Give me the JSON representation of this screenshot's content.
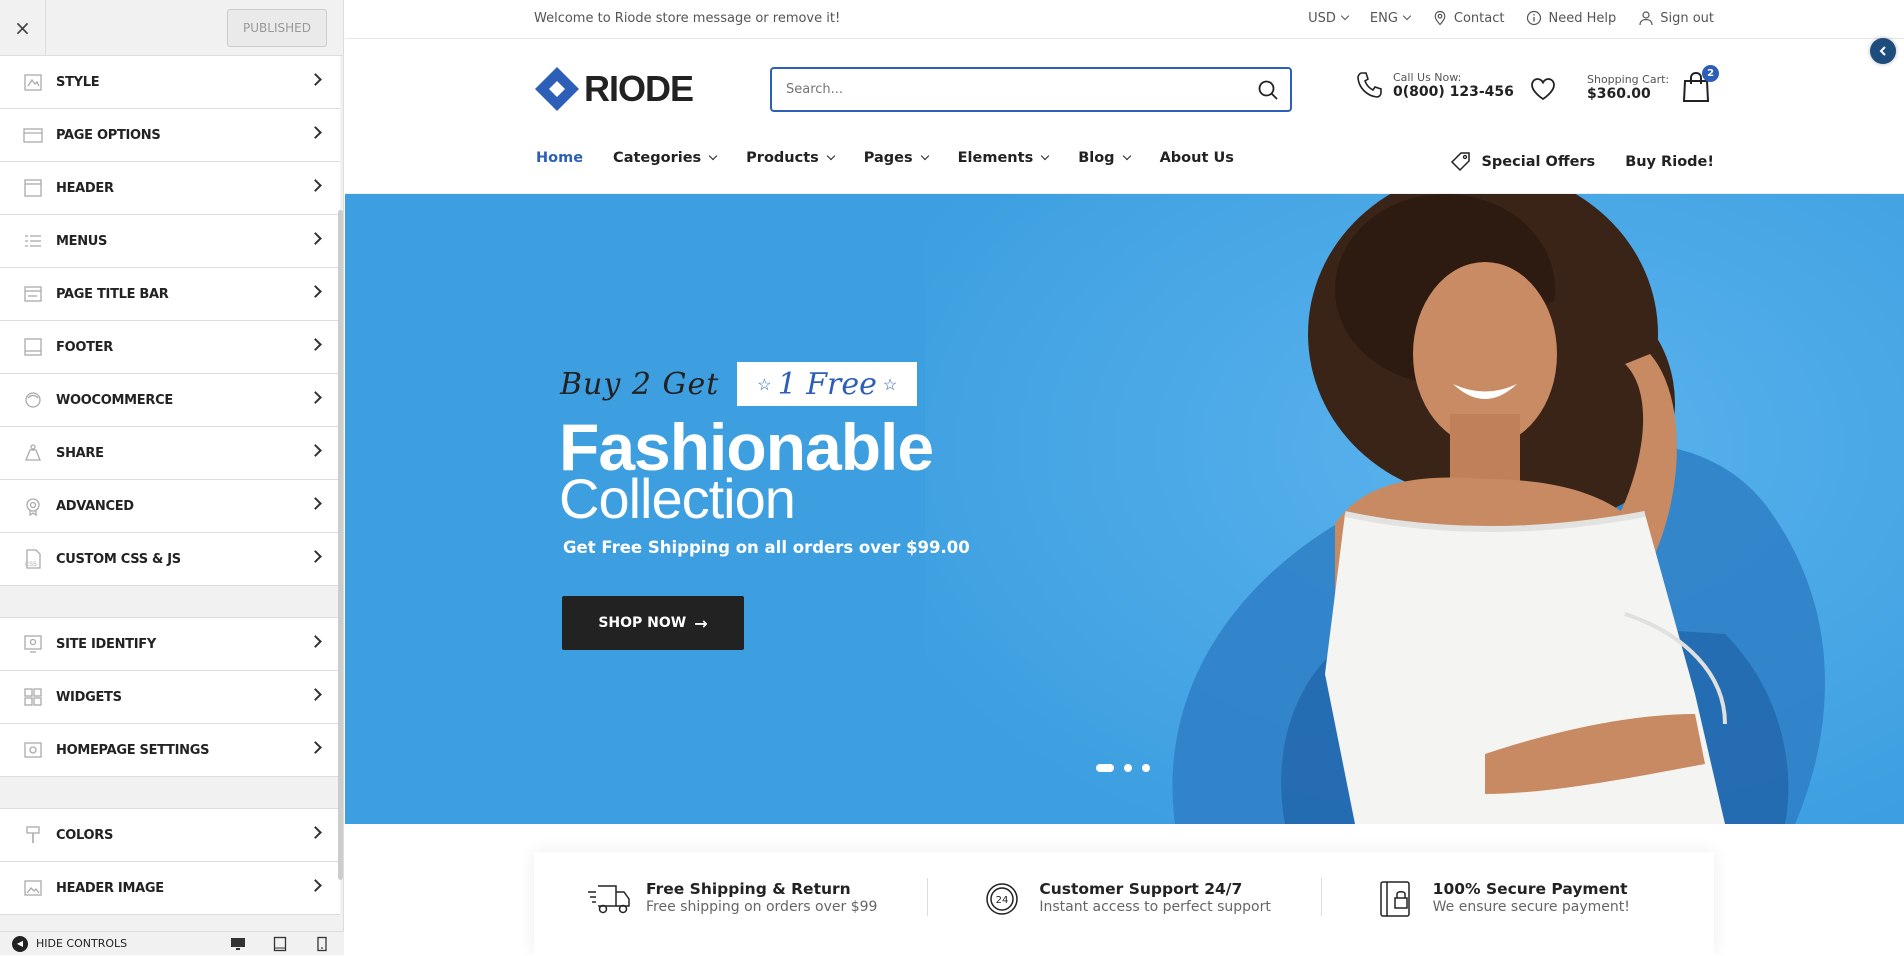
{
  "customizer": {
    "close_label": "×",
    "publish_label": "PUBLISHED",
    "sections_group1": [
      {
        "label": "STYLE",
        "icon": "style-icon"
      },
      {
        "label": "PAGE OPTIONS",
        "icon": "page-options-icon"
      },
      {
        "label": "HEADER",
        "icon": "header-icon"
      },
      {
        "label": "MENUS",
        "icon": "menus-icon"
      },
      {
        "label": "PAGE TITLE BAR",
        "icon": "page-title-bar-icon"
      },
      {
        "label": "FOOTER",
        "icon": "footer-icon"
      },
      {
        "label": "WOOCOMMERCE",
        "icon": "woocommerce-icon"
      },
      {
        "label": "SHARE",
        "icon": "share-icon"
      },
      {
        "label": "ADVANCED",
        "icon": "advanced-icon"
      },
      {
        "label": "CUSTOM CSS & JS",
        "icon": "custom-css-icon"
      }
    ],
    "sections_group2": [
      {
        "label": "SITE IDENTIFY",
        "icon": "site-identity-icon"
      },
      {
        "label": "WIDGETS",
        "icon": "widgets-icon"
      },
      {
        "label": "HOMEPAGE SETTINGS",
        "icon": "homepage-settings-icon"
      }
    ],
    "sections_group3": [
      {
        "label": "COLORS",
        "icon": "colors-icon"
      },
      {
        "label": "HEADER IMAGE",
        "icon": "header-image-icon"
      }
    ],
    "hide_controls_label": "HIDE CONTROLS"
  },
  "topbar": {
    "welcome": "Welcome to Riode store message or remove it!",
    "currency": "USD",
    "language": "ENG",
    "contact": "Contact",
    "help": "Need Help",
    "signout": "Sign out"
  },
  "header": {
    "logo_text": "RIODE",
    "search_placeholder": "Search...",
    "call_label": "Call Us Now:",
    "call_number": "0(800) 123-456",
    "cart_label": "Shopping Cart:",
    "cart_total": "$360.00",
    "cart_count": "2"
  },
  "nav": {
    "items": [
      "Home",
      "Categories",
      "Products",
      "Pages",
      "Elements",
      "Blog",
      "About Us"
    ],
    "special_offers": "Special Offers",
    "buy": "Buy Riode!"
  },
  "hero": {
    "buy_text": "Buy 2 Get",
    "free_text": "1 Free",
    "title_line1": "Fashionable",
    "title_line2": "Collection",
    "subtitle": "Get Free Shipping on all orders over $99.00",
    "button": "SHOP NOW",
    "button_arrow": "→",
    "active_slide": 1,
    "slides": 3
  },
  "features": [
    {
      "title": "Free Shipping & Return",
      "subtitle": "Free shipping on orders over $99",
      "icon": "truck-icon"
    },
    {
      "title": "Customer Support 24/7",
      "subtitle": "Instant access to perfect support",
      "icon": "support-24-icon"
    },
    {
      "title": "100% Secure Payment",
      "subtitle": "We ensure secure payment!",
      "icon": "secure-payment-icon"
    }
  ],
  "colors": {
    "accent": "#2d5fb8",
    "hero_bg": "#3d9fe0",
    "dark": "#222222"
  }
}
